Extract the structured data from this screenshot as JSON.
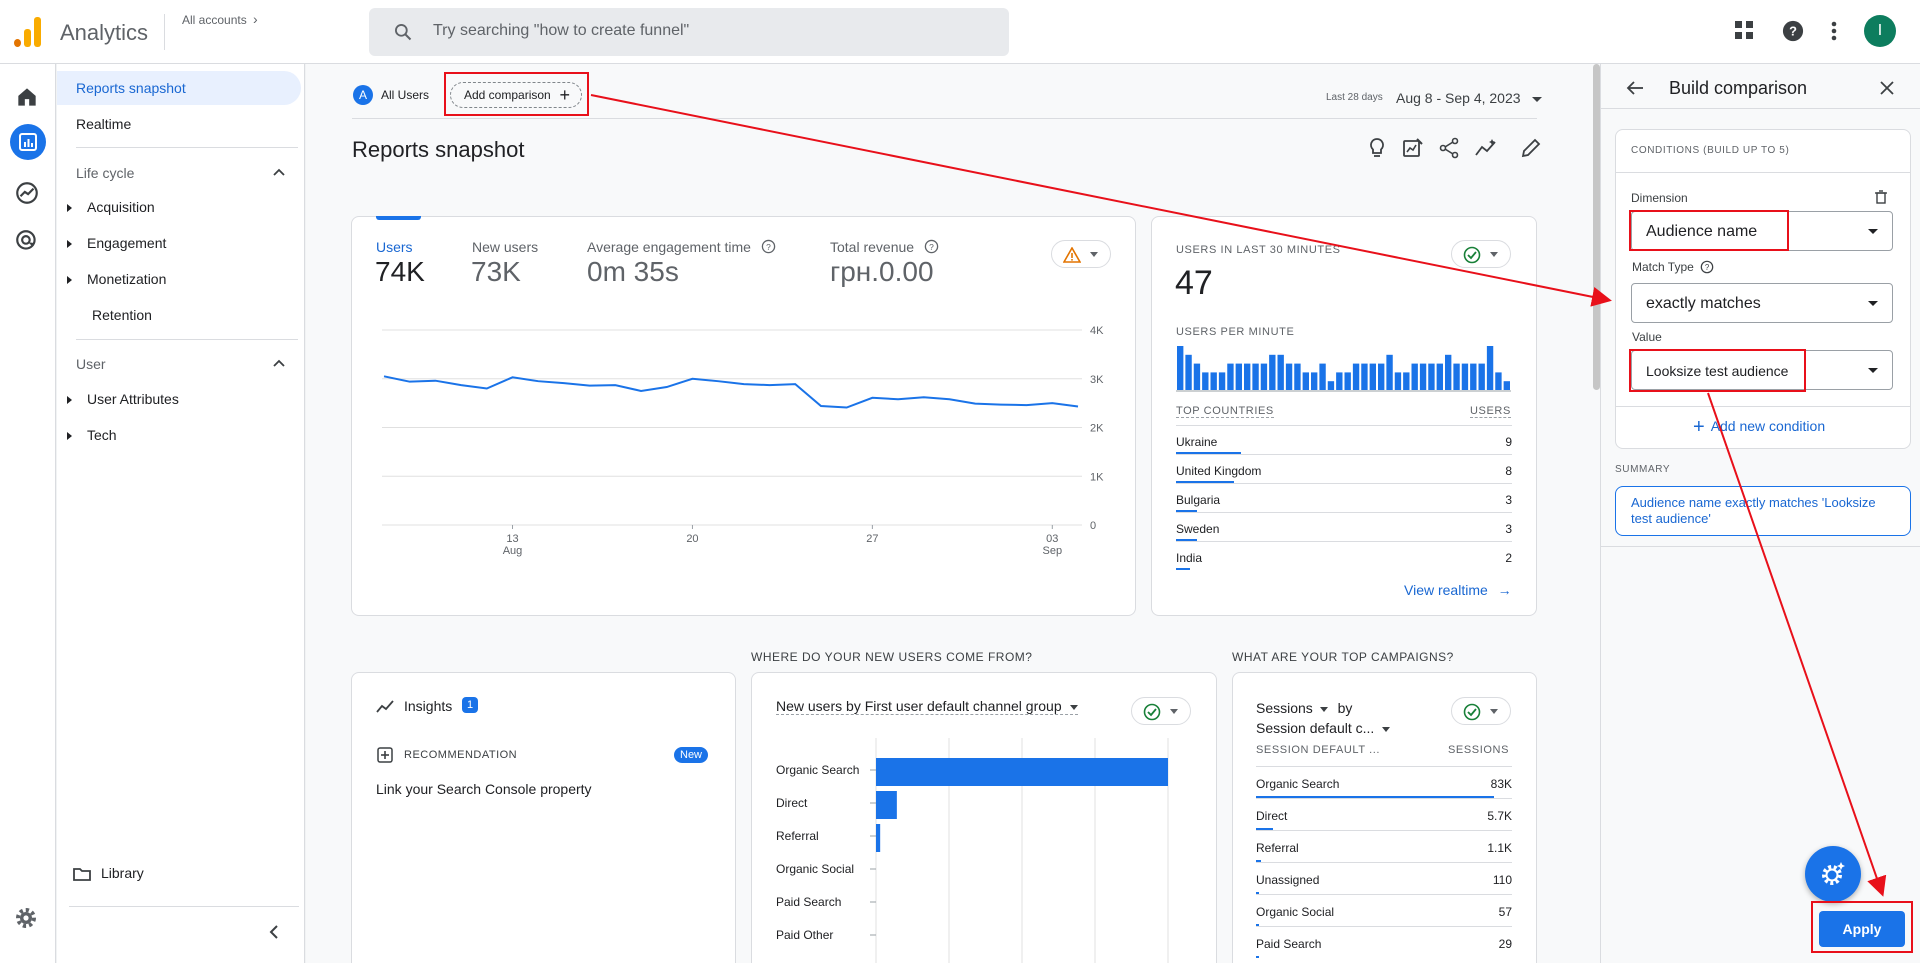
{
  "app": {
    "title": "Analytics",
    "accounts_label": "All accounts",
    "search_placeholder": "Try searching \"how to create funnel\"",
    "avatar_letter": "I"
  },
  "nav": {
    "reports_snapshot": "Reports snapshot",
    "realtime": "Realtime",
    "lifecycle": {
      "label": "Life cycle",
      "items": [
        "Acquisition",
        "Engagement",
        "Monetization",
        "Retention"
      ]
    },
    "user": {
      "label": "User",
      "items": [
        "User Attributes",
        "Tech"
      ]
    },
    "library": "Library"
  },
  "toolbar": {
    "audience_chip_letter": "A",
    "audience_chip": "All Users",
    "add_comparison": "Add comparison",
    "date_prefix": "Last 28 days",
    "date_range": "Aug 8 - Sep 4, 2023"
  },
  "page_title": "Reports snapshot",
  "metrics": [
    {
      "label": "Users",
      "value": "74K"
    },
    {
      "label": "New users",
      "value": "73K"
    },
    {
      "label": "Average engagement time",
      "value": "0m 35s"
    },
    {
      "label": "Total revenue",
      "value": "грн.0.00"
    }
  ],
  "chart_data": [
    {
      "type": "line",
      "x": [
        "Aug 8",
        "Aug 9",
        "Aug 10",
        "Aug 11",
        "Aug 12",
        "Aug 13",
        "Aug 14",
        "Aug 15",
        "Aug 16",
        "Aug 17",
        "Aug 18",
        "Aug 19",
        "Aug 20",
        "Aug 21",
        "Aug 22",
        "Aug 23",
        "Aug 24",
        "Aug 25",
        "Aug 26",
        "Aug 27",
        "Aug 28",
        "Aug 29",
        "Aug 30",
        "Aug 31",
        "Sep 1",
        "Sep 2",
        "Sep 3",
        "Sep 4"
      ],
      "values": [
        3050,
        2940,
        2960,
        2870,
        2800,
        3030,
        2950,
        2910,
        2860,
        2870,
        2750,
        2830,
        3000,
        2950,
        2890,
        2870,
        2890,
        2440,
        2410,
        2610,
        2580,
        2620,
        2580,
        2490,
        2470,
        2460,
        2500,
        2430
      ],
      "yticks": [
        "4K",
        "3K",
        "2K",
        "1K",
        "0"
      ],
      "ylim": [
        0,
        4000
      ],
      "xticks": [
        {
          "day": "13",
          "month": "Aug"
        },
        {
          "day": "20",
          "month": ""
        },
        {
          "day": "27",
          "month": ""
        },
        {
          "day": "03",
          "month": "Sep"
        }
      ],
      "grid": true
    },
    {
      "type": "bar",
      "title": "USERS PER MINUTE",
      "values": [
        5,
        4,
        3,
        2,
        2,
        2,
        3,
        3,
        3,
        3,
        3,
        4,
        4,
        3,
        3,
        2,
        2,
        3,
        1,
        2,
        2,
        3,
        3,
        3,
        3,
        4,
        2,
        2,
        3,
        3,
        3,
        3,
        4,
        3,
        3,
        3,
        3,
        5,
        2,
        1
      ],
      "ylim": [
        0,
        5
      ]
    },
    {
      "type": "bar",
      "title": "New users by First user default channel group",
      "categories": [
        "Organic Search",
        "Direct",
        "Referral",
        "Organic Social",
        "Paid Search",
        "Paid Other"
      ],
      "values": [
        70000,
        5000,
        1000,
        0,
        0,
        0
      ],
      "xlim": [
        0,
        70000
      ],
      "grid": true
    }
  ],
  "realtime": {
    "label": "USERS IN LAST 30 MINUTES",
    "value": "47",
    "per_minute": "USERS PER MINUTE",
    "countries_header": "TOP COUNTRIES",
    "users_header": "USERS",
    "countries": [
      {
        "name": "Ukraine",
        "users": "9",
        "share": 1.0
      },
      {
        "name": "United Kingdom",
        "users": "8",
        "share": 0.89
      },
      {
        "name": "Bulgaria",
        "users": "3",
        "share": 0.33
      },
      {
        "name": "Sweden",
        "users": "3",
        "share": 0.33
      },
      {
        "name": "India",
        "users": "2",
        "share": 0.22
      }
    ],
    "view_realtime": "View realtime"
  },
  "insights": {
    "title": "Insights",
    "count": "1",
    "rec_label": "RECOMMENDATION",
    "badge": "New",
    "text": "Link your Search Console property"
  },
  "new_users": {
    "heading": "WHERE DO YOUR NEW USERS COME FROM?",
    "dropdown_metric": "New users",
    "dropdown_by": "by",
    "dropdown_dim": "First user default channel group"
  },
  "campaigns": {
    "heading": "WHAT ARE YOUR TOP CAMPAIGNS?",
    "metric": "Sessions",
    "by": "by",
    "dimension": "Session default c...",
    "col1": "SESSION DEFAULT ...",
    "col2": "SESSIONS",
    "rows": [
      {
        "name": "Organic Search",
        "value": "83K",
        "share": 1.0
      },
      {
        "name": "Direct",
        "value": "5.7K",
        "share": 0.07
      },
      {
        "name": "Referral",
        "value": "1.1K",
        "share": 0.02
      },
      {
        "name": "Unassigned",
        "value": "110",
        "share": 0.005
      },
      {
        "name": "Organic Social",
        "value": "57",
        "share": 0.004
      },
      {
        "name": "Paid Search",
        "value": "29",
        "share": 0.003
      }
    ]
  },
  "panel": {
    "title": "Build comparison",
    "conditions_label": "CONDITIONS (BUILD UP TO 5)",
    "dimension_label": "Dimension",
    "dimension_value": "Audience name",
    "match_label": "Match Type",
    "match_value": "exactly matches",
    "value_label": "Value",
    "value_value": "Looksize test audience",
    "add_condition": "Add new condition",
    "summary_label": "SUMMARY",
    "summary_text": "Audience name exactly matches 'Looksize test audience'",
    "apply": "Apply"
  },
  "colors": {
    "accent": "#1a73e8",
    "annotation": "#e8101a",
    "logo": "#f9ab00",
    "avatar": "#0d7d5e"
  }
}
